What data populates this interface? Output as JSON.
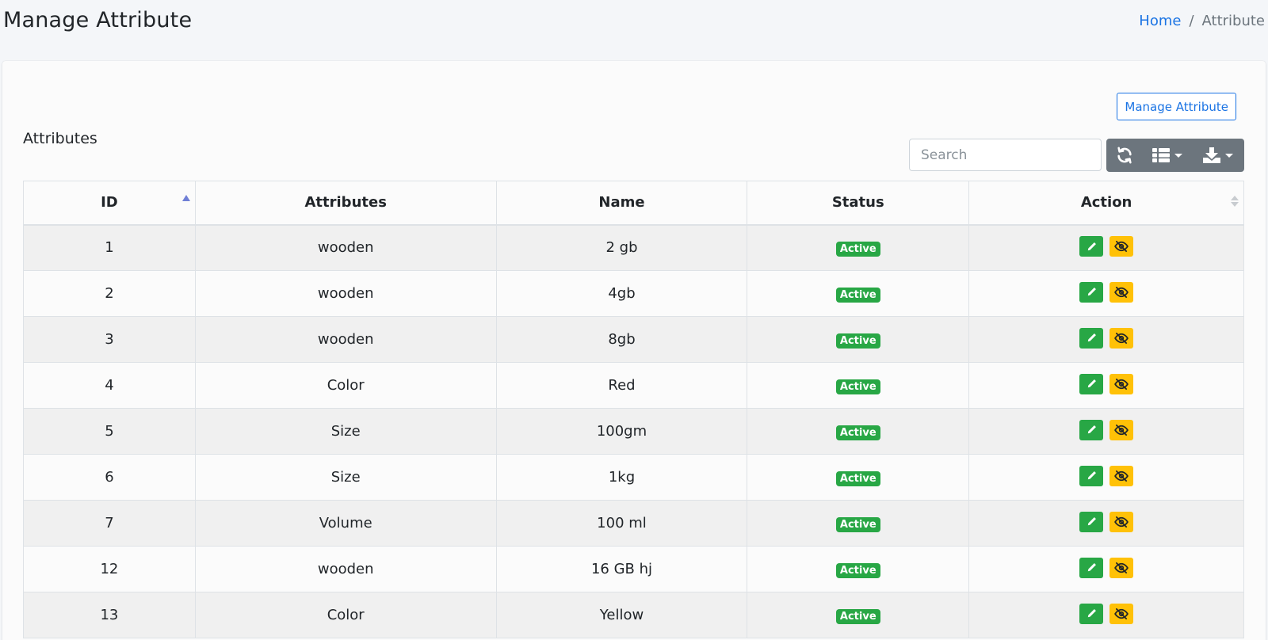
{
  "header": {
    "title": "Manage Attribute",
    "breadcrumb": {
      "home": "Home",
      "separator": "/",
      "current": "Attribute"
    }
  },
  "card": {
    "manage_button": "Manage Attribute",
    "section_title": "Attributes",
    "search": {
      "placeholder": "Search",
      "value": ""
    },
    "toolbar_icons": [
      "refresh-icon",
      "columns-list-icon",
      "download-icon"
    ]
  },
  "table": {
    "columns": [
      "ID",
      "Attributes",
      "Name",
      "Status",
      "Action"
    ],
    "rows": [
      {
        "id": "1",
        "attribute": "wooden",
        "name": "2 gb",
        "status": "Active"
      },
      {
        "id": "2",
        "attribute": "wooden",
        "name": "4gb",
        "status": "Active"
      },
      {
        "id": "3",
        "attribute": "wooden",
        "name": "8gb",
        "status": "Active"
      },
      {
        "id": "4",
        "attribute": "Color",
        "name": "Red",
        "status": "Active"
      },
      {
        "id": "5",
        "attribute": "Size",
        "name": "100gm",
        "status": "Active"
      },
      {
        "id": "6",
        "attribute": "Size",
        "name": "1kg",
        "status": "Active"
      },
      {
        "id": "7",
        "attribute": "Volume",
        "name": "100 ml",
        "status": "Active"
      },
      {
        "id": "12",
        "attribute": "wooden",
        "name": "16 GB hj",
        "status": "Active"
      },
      {
        "id": "13",
        "attribute": "Color",
        "name": "Yellow",
        "status": "Active"
      }
    ]
  },
  "colors": {
    "primary": "#1b74e4",
    "success": "#28a745",
    "warning": "#ffc107",
    "secondary": "#6c757d"
  }
}
